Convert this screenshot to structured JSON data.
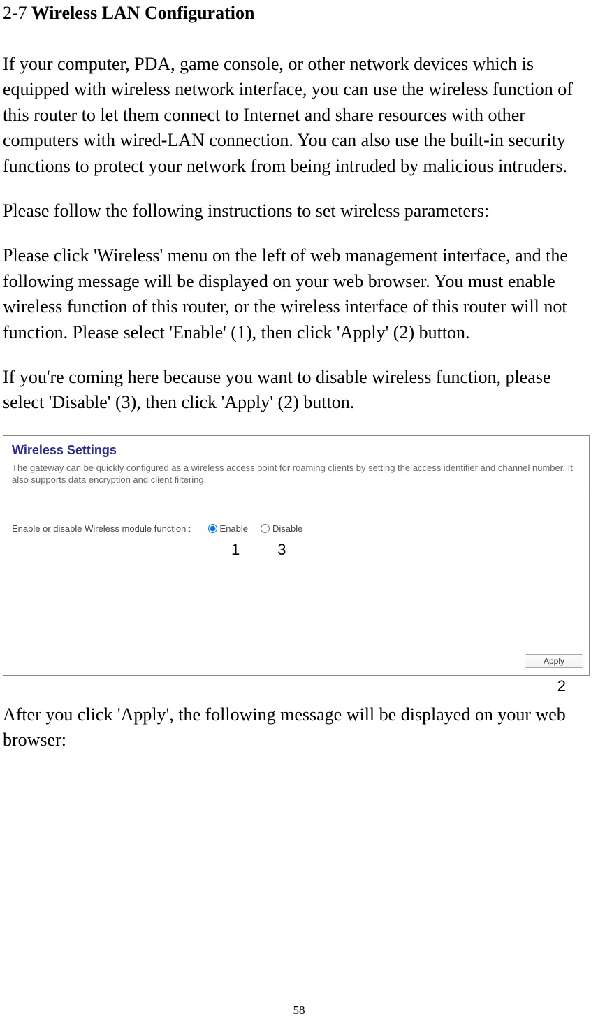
{
  "heading": {
    "number": "2-7",
    "title": "Wireless LAN Configuration"
  },
  "paragraphs": {
    "p1": "If your computer, PDA, game console, or other network devices which is equipped with wireless network interface, you can use the wireless function of this router to let them connect to Internet and share resources with other computers with wired-LAN connection. You can also use the built-in security functions to protect your network from being intruded by malicious intruders.",
    "p2": "Please follow the following instructions to set wireless parameters:",
    "p3": "Please click 'Wireless' menu on the left of web management interface, and the following message will be displayed on your web browser. You must enable wireless function of this router, or the wireless interface of this router will not function. Please select 'Enable' (1), then click 'Apply' (2) button.",
    "p4": "If you're coming here because you want to disable wireless function, please select 'Disable' (3), then click 'Apply' (2) button.",
    "p5": "After you click 'Apply', the following message will be displayed on your web browser:"
  },
  "screenshot": {
    "title": "Wireless Settings",
    "description": "The gateway can be quickly configured as a wireless access point for roaming clients by setting the access identifier and channel number. It also supports data encryption and client filtering.",
    "control_label": "Enable or disable Wireless module function :",
    "enable_label": "Enable",
    "disable_label": "Disable",
    "apply_label": "Apply"
  },
  "annotations": {
    "a1": "1",
    "a2": "2",
    "a3": "3"
  },
  "page_number": "58"
}
